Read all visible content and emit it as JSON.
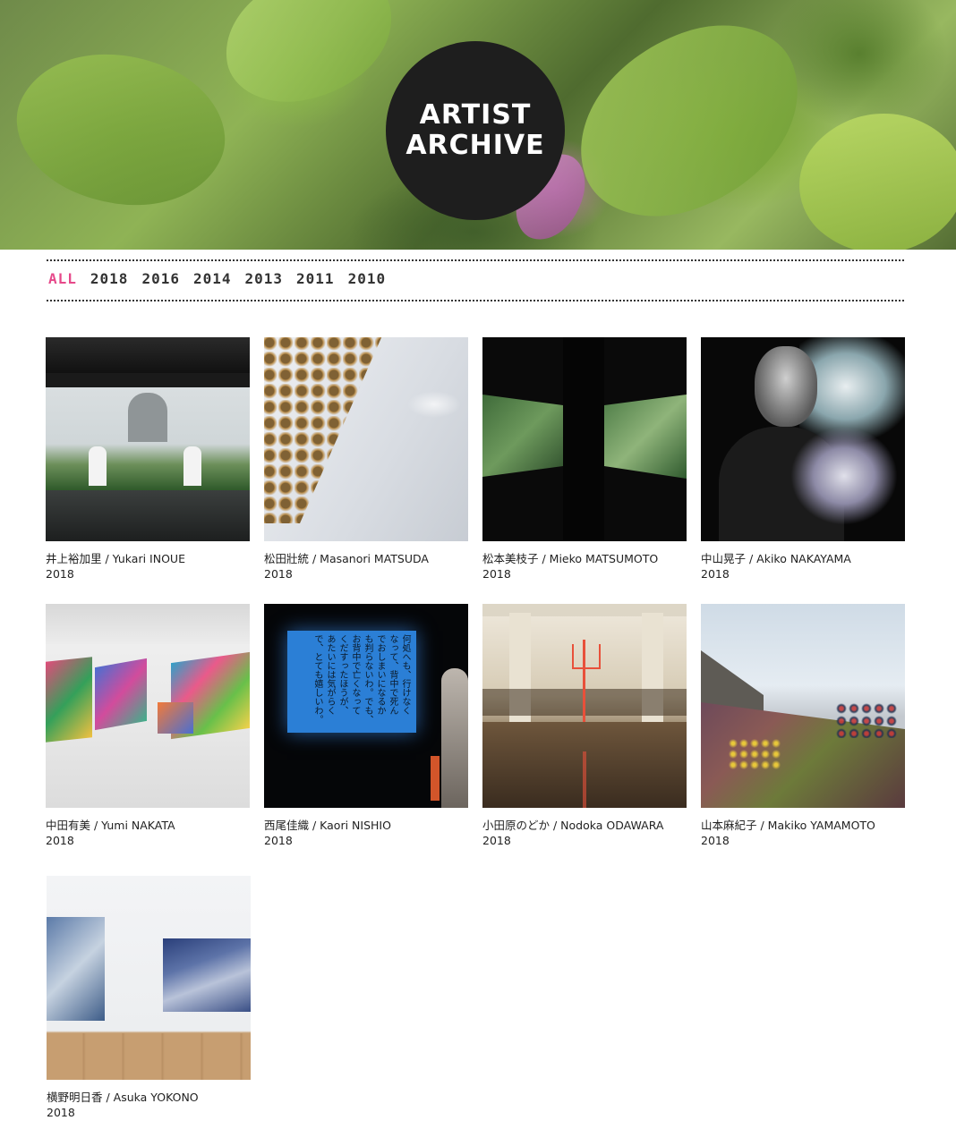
{
  "header": {
    "title_line1": "ARTIST",
    "title_line2": "ARCHIVE"
  },
  "year_filter": {
    "items": [
      {
        "label": "ALL",
        "active": true
      },
      {
        "label": "2018",
        "active": false
      },
      {
        "label": "2016",
        "active": false
      },
      {
        "label": "2014",
        "active": false
      },
      {
        "label": "2013",
        "active": false
      },
      {
        "label": "2011",
        "active": false
      },
      {
        "label": "2010",
        "active": false
      }
    ],
    "active_color": "#e6498a"
  },
  "artists": [
    {
      "name": "井上裕加里 / Yukari INOUE",
      "year": "2018"
    },
    {
      "name": "松田壯統 / Masanori MATSUDA",
      "year": "2018"
    },
    {
      "name": "松本美枝子 / Mieko MATSUMOTO",
      "year": "2018"
    },
    {
      "name": "中山晃子 / Akiko NAKAYAMA",
      "year": "2018"
    },
    {
      "name": "中田有美 / Yumi NAKATA",
      "year": "2018"
    },
    {
      "name": "西尾佳織 / Kaori NISHIO",
      "year": "2018"
    },
    {
      "name": "小田原のどか / Nodoka ODAWARA",
      "year": "2018"
    },
    {
      "name": "山本麻紀子 / Makiko YAMAMOTO",
      "year": "2018"
    },
    {
      "name": "横野明日香 / Asuka YOKONO",
      "year": "2018"
    }
  ],
  "projection_text": [
    "何処へも、行けなく",
    "なって、背中で死ん",
    "でおしまいになるか",
    "も判らないわ。でも、",
    "お背中で亡くなって",
    "くだすったほうが、",
    "あたいには気がらく",
    "で、とても嬉しいわ。"
  ]
}
